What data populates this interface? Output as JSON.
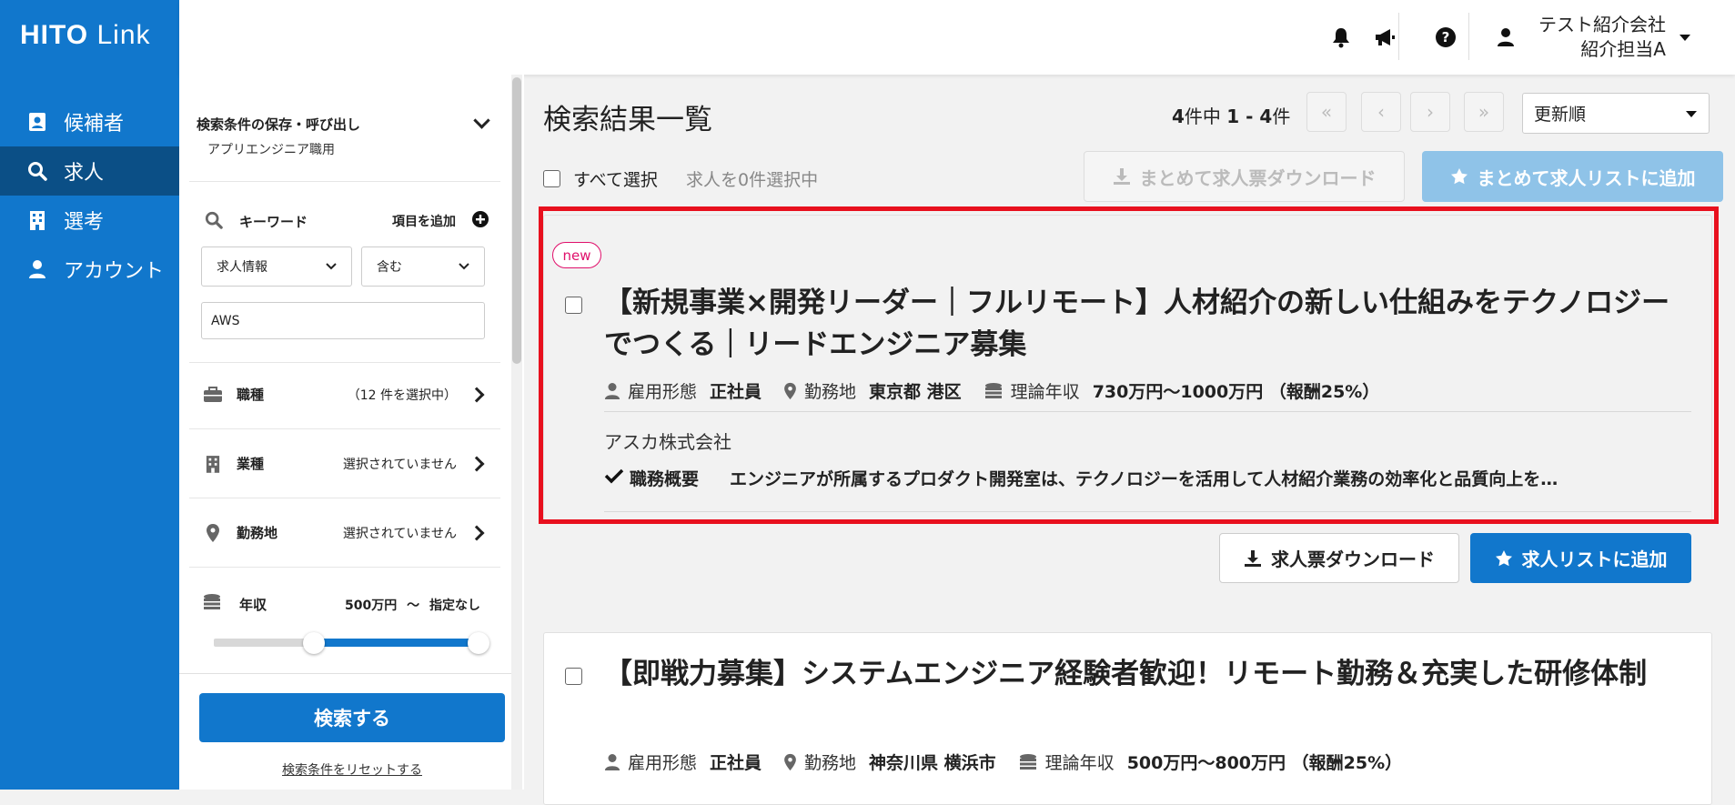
{
  "brand": {
    "logo_bold": "HITO",
    "logo_light": "Link"
  },
  "nav": [
    {
      "label": "候補者",
      "icon": "candidate-icon"
    },
    {
      "label": "求人",
      "icon": "search-icon"
    },
    {
      "label": "選考",
      "icon": "building-icon"
    },
    {
      "label": "アカウント",
      "icon": "person-icon"
    }
  ],
  "header": {
    "company": "テスト紹介会社",
    "user": "紹介担当A"
  },
  "filter": {
    "saved_title": "検索条件の保存・呼び出し",
    "saved_sub": "アプリエンジニア職用",
    "keyword_label": "キーワード",
    "add_item_label": "項目を追加",
    "field_select": "求人情報",
    "match_select": "含む",
    "keyword_value": "AWS",
    "job_type_label": "職種",
    "job_type_value": "（12 件を選択中）",
    "industry_label": "業種",
    "industry_value": "選択されていません",
    "location_label": "勤務地",
    "location_value": "選択されていません",
    "salary_label": "年収",
    "salary_min": "500万円",
    "salary_sep": "〜",
    "salary_max": "指定なし",
    "salary_range": {
      "min_fraction": 0.38,
      "max_fraction": 1.0
    },
    "search_button": "検索する",
    "reset_link": "検索条件をリセットする"
  },
  "results": {
    "title": "検索結果一覧",
    "count_total": "4",
    "count_text_a": "件中",
    "count_range": "1 - 4",
    "count_text_b": "件",
    "sort_value": "更新順",
    "select_all": "すべて選択",
    "selected_count": "求人を0件選択中",
    "bulk_download": "まとめて求人票ダウンロード",
    "bulk_add": "まとめて求人リストに追加"
  },
  "jobs": [
    {
      "badge": "new",
      "title": "【新規事業×開発リーダー｜フルリモート】人材紹介の新しい仕組みをテクノロジーでつくる｜リードエンジニア募集",
      "employment_label": "雇用形態",
      "employment": "正社員",
      "location_label": "勤務地",
      "location": "東京都 港区",
      "salary_label": "理論年収",
      "salary": "730万円〜1000万円 （報酬25%）",
      "company": "アスカ株式会社",
      "summary_label": "職務概要",
      "summary": "エンジニアが所属するプロダクト開発室は、テクノロジーを活用して人材紹介業務の効率化と品質向上を…",
      "download_button": "求人票ダウンロード",
      "add_button": "求人リストに追加"
    },
    {
      "title": "【即戦力募集】システムエンジニア経験者歓迎！リモート勤務＆充実した研修体制",
      "employment_label": "雇用形態",
      "employment": "正社員",
      "location_label": "勤務地",
      "location": "神奈川県 横浜市",
      "salary_label": "理論年収",
      "salary": "500万円〜800万円 （報酬25%）"
    }
  ]
}
